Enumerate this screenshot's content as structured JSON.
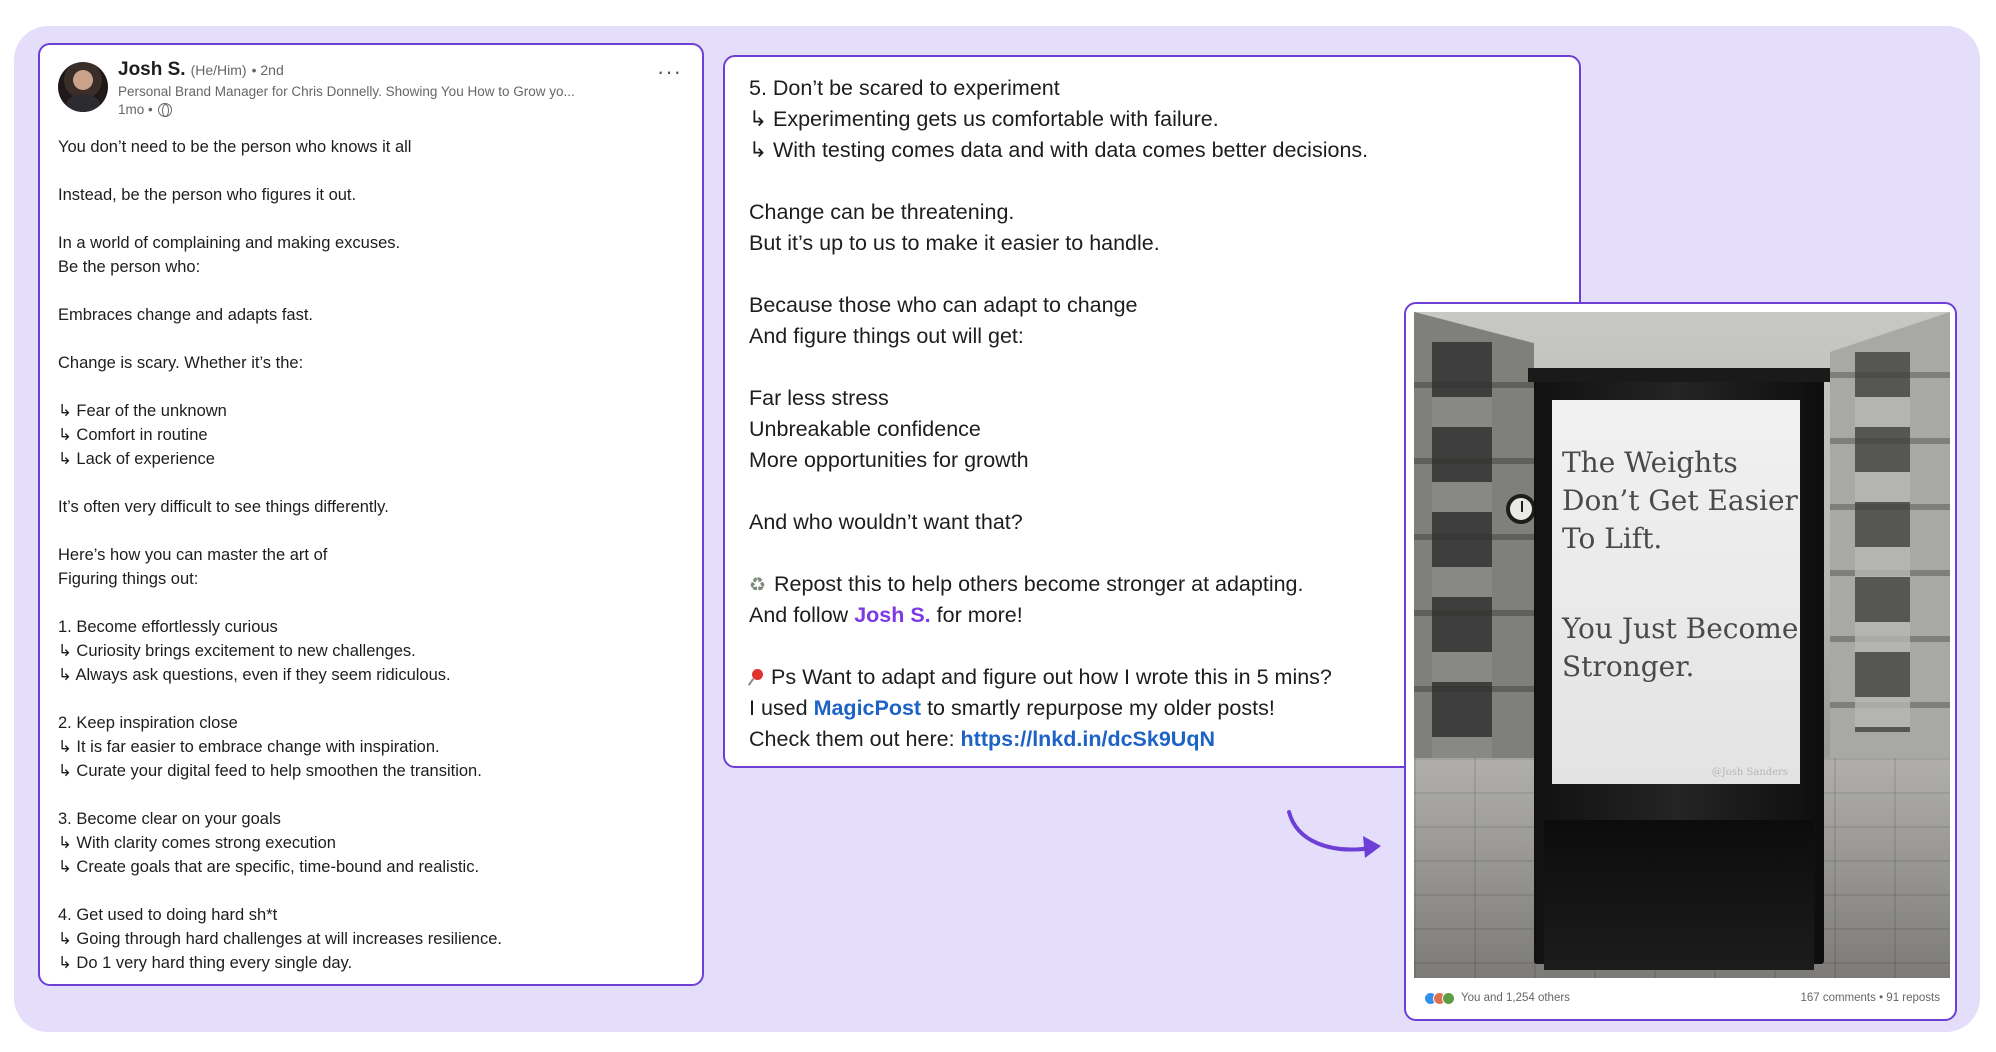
{
  "post": {
    "author_name": "Josh S.",
    "pronouns": "(He/Him)",
    "degree": "• 2nd",
    "headline": "Personal Brand Manager for Chris Donnelly. Showing You How to Grow yo...",
    "time": "1mo •",
    "more_label": "···",
    "lines": [
      "You don’t need to be the person who knows it all",
      "",
      "Instead, be the person who figures it out.",
      "",
      "In a world of complaining and making excuses.",
      "Be the person who:",
      "",
      "Embraces change and adapts fast.",
      "",
      "Change is scary. Whether it’s the:",
      "",
      "↳ Fear of the unknown",
      "↳ Comfort in routine",
      "↳ Lack of experience",
      "",
      "It’s often very difficult to see things differently.",
      "",
      "Here’s how you can master the art of",
      "Figuring things out:",
      "",
      "1. Become effortlessly curious",
      "↳ Curiosity brings excitement to new challenges.",
      "↳ Always ask questions, even if they seem ridiculous.",
      "",
      "2. Keep inspiration close",
      "↳ It is far easier to embrace change with inspiration.",
      "↳ Curate your digital feed to help smoothen the transition.",
      "",
      "3. Become clear on your goals",
      "↳ With clarity comes strong execution",
      "↳ Create goals that are specific, time-bound and realistic.",
      "",
      "4. Get used to doing hard sh*t",
      "↳ Going through hard challenges at will increases resilience.",
      "↳ Do 1 very hard thing every single day."
    ]
  },
  "continuation": {
    "lines": [
      "5. Don’t be scared to experiment",
      "↳ Experimenting gets us comfortable with failure.",
      "↳ With testing comes data and with data comes better decisions.",
      "",
      "Change can be threatening.",
      "But it’s up to us to make it easier to handle.",
      "",
      "Because those who can adapt to change",
      "And figure things out will get:",
      "",
      "Far less stress",
      "Unbreakable confidence",
      "More opportunities for growth",
      "",
      "And who wouldn’t want that?",
      ""
    ],
    "repost_icon": "♻",
    "repost_line": "Repost this to help others become stronger at adapting.",
    "follow_prefix": "And follow",
    "follow_name": "Josh S.",
    "follow_suffix": "for more!",
    "ps_icon": "pushpin-icon",
    "ps_line": "Ps Want to adapt and figure out how I wrote this in 5 mins?",
    "used_prefix": "I used",
    "used_tool": "MagicPost",
    "used_suffix": "to smartly repurpose my older posts!",
    "check_prefix": "Check them out here:",
    "check_link": "https://lnkd.in/dcSk9UqN"
  },
  "image_post": {
    "poster_lines_top": [
      "The Weights",
      "Don’t Get Easier",
      "To Lift."
    ],
    "poster_lines_bottom": [
      "You Just Become",
      "Stronger."
    ],
    "poster_credit": "@Josh Sanders",
    "reactions_text": "You and 1,254 others",
    "stats_text": "167 comments • 91 reposts"
  },
  "colors": {
    "accent": "#6d3fd6",
    "backdrop": "#e5defb",
    "mention": "#7b3ae6",
    "link": "#1d63c7"
  }
}
